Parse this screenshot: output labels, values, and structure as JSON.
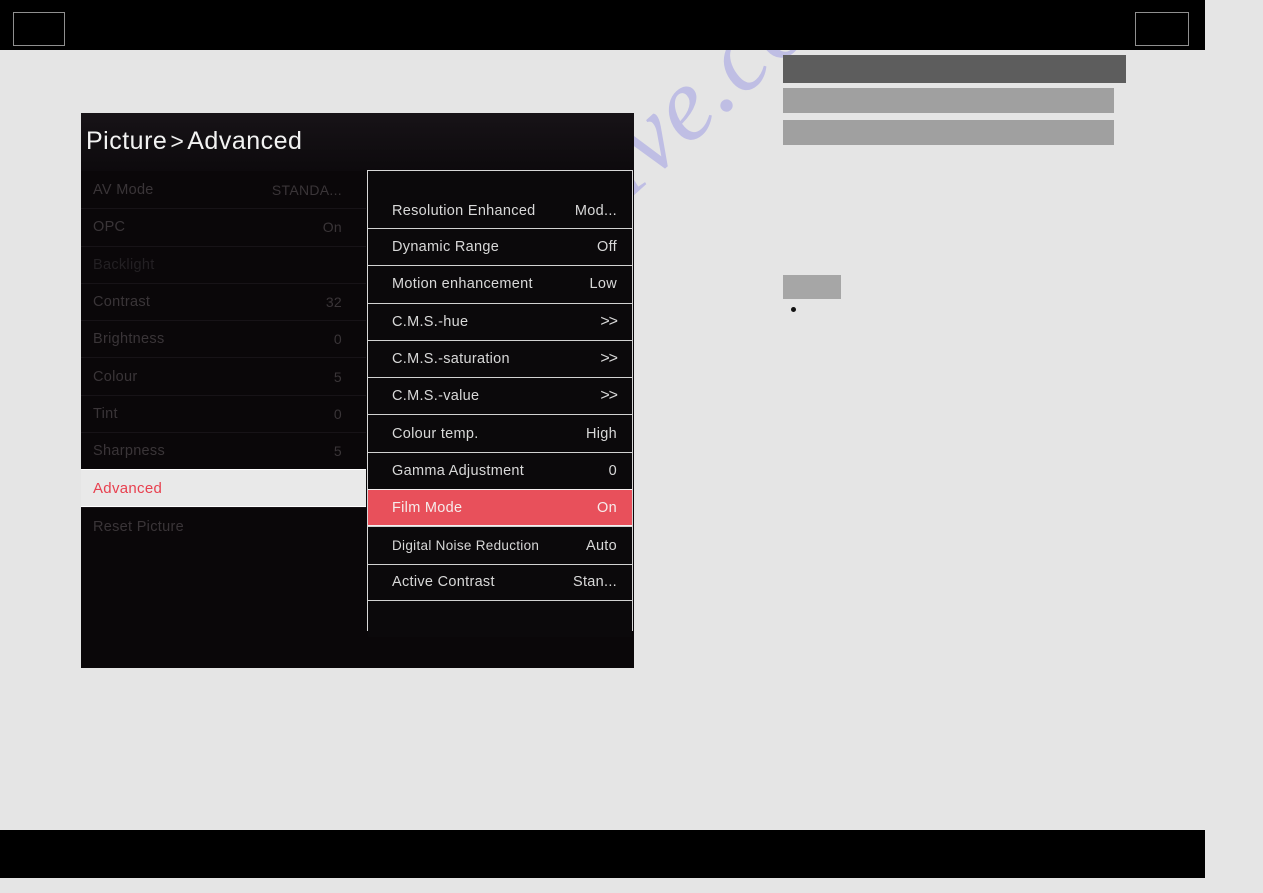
{
  "osd": {
    "title_primary": "Picture",
    "title_separator": ">",
    "title_secondary": "Advanced",
    "accent_color": "#e8505b",
    "selected_color": "#e8404f",
    "panel_bg": "#0a0709",
    "left_menu": [
      {
        "label": "AV Mode",
        "value": "STANDA...",
        "state": "normal"
      },
      {
        "label": "OPC",
        "value": "On",
        "state": "normal"
      },
      {
        "label": "Backlight",
        "value": "",
        "state": "dim"
      },
      {
        "label": "Contrast",
        "value": "32",
        "state": "normal"
      },
      {
        "label": "Brightness",
        "value": "0",
        "state": "normal"
      },
      {
        "label": "Colour",
        "value": "5",
        "state": "normal"
      },
      {
        "label": "Tint",
        "value": "0",
        "state": "normal"
      },
      {
        "label": "Sharpness",
        "value": "5",
        "state": "normal"
      },
      {
        "label": "Advanced",
        "value": "",
        "state": "selected"
      },
      {
        "label": "Reset Picture",
        "value": "",
        "state": "normal"
      }
    ],
    "submenu": [
      {
        "label": "Resolution Enhanced",
        "value": "Mod...",
        "kind": "value"
      },
      {
        "label": "Dynamic Range",
        "value": "Off",
        "kind": "value"
      },
      {
        "label": "Motion enhancement",
        "value": "Low",
        "kind": "value"
      },
      {
        "label": "C.M.S.-hue",
        "value": ">>",
        "kind": "arrow"
      },
      {
        "label": "C.M.S.-saturation",
        "value": ">>",
        "kind": "arrow"
      },
      {
        "label": "C.M.S.-value",
        "value": ">>",
        "kind": "arrow"
      },
      {
        "label": "Colour temp.",
        "value": "High",
        "kind": "value"
      },
      {
        "label": "Gamma Adjustment",
        "value": "0",
        "kind": "value"
      },
      {
        "label": "Film Mode",
        "value": "On",
        "kind": "value",
        "highlight": true
      },
      {
        "label": "Digital Noise Reduction",
        "value": "Auto",
        "kind": "value"
      },
      {
        "label": "Active Contrast",
        "value": "Stan...",
        "kind": "value"
      }
    ]
  },
  "page": {
    "background_color": "#e5e5e5",
    "bar_color": "#000000",
    "watermark_text": "manualshive.com",
    "watermark_color": "#b9b8e4"
  }
}
